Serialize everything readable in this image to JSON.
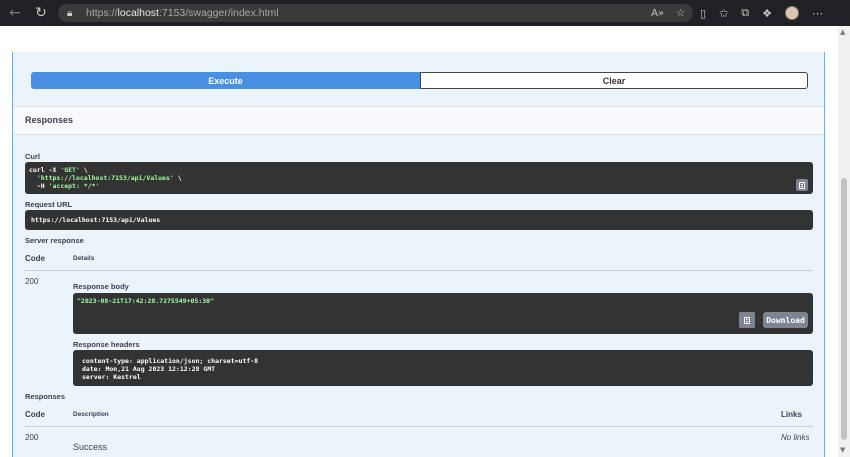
{
  "browser": {
    "url_prefix": "https://",
    "url_host": "localhost",
    "url_rest": ":7153/swagger/index.html",
    "icons": [
      "back-icon",
      "reload-icon",
      "lock-icon",
      "read-aloud-icon",
      "favorite-icon",
      "split-screen-icon",
      "favorites-icon",
      "collections-icon",
      "extension-icon",
      "profile-avatar"
    ]
  },
  "actions": {
    "execute_label": "Execute",
    "clear_label": "Clear"
  },
  "responses_section": {
    "title": "Responses"
  },
  "curl": {
    "label": "Curl",
    "lines": [
      {
        "prefix": "curl -X ",
        "str": "'GET'",
        "suffix": " \\"
      },
      {
        "prefix": "  ",
        "str": "'https://localhost:7153/api/Values'",
        "suffix": " \\"
      },
      {
        "prefix": "  -H ",
        "str": "'accept: */*'",
        "suffix": ""
      }
    ]
  },
  "request_url": {
    "label": "Request URL",
    "value": "https://localhost:7153/api/Values"
  },
  "server_response": {
    "label": "Server response",
    "col_code": "Code",
    "col_details": "Details",
    "code": "200",
    "body_label": "Response body",
    "body": "\"2023-08-21T17:42:28.7275549+05:30\"",
    "download_label": "Download",
    "headers_label": "Response headers",
    "headers": [
      "content-type: application/json; charset=utf-8",
      "date: Mon,21 Aug 2023 12:12:28 GMT",
      "server: Kestrel"
    ]
  },
  "responses_table": {
    "label": "Responses",
    "col_code": "Code",
    "col_description": "Description",
    "col_links": "Links",
    "code": "200",
    "description": "Success",
    "links": "No links"
  }
}
